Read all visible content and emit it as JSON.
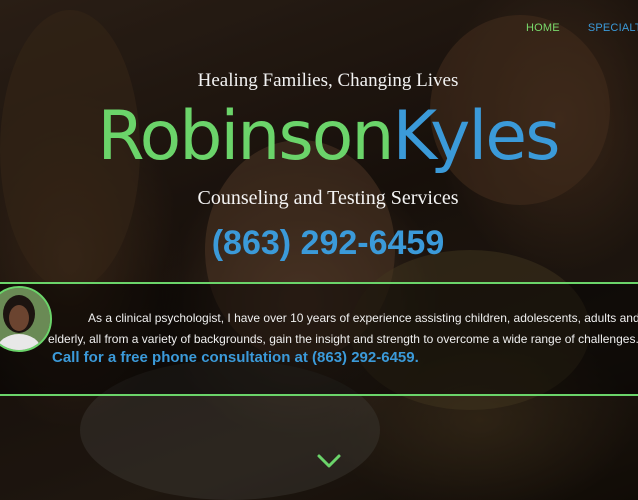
{
  "nav": {
    "items": [
      {
        "label": "HOME"
      },
      {
        "label": "SPECIALTIES"
      }
    ]
  },
  "hero": {
    "tagline": "Healing Families, Changing Lives",
    "brand_first": "Robinson",
    "brand_second": "Kyles",
    "subtitle": "Counseling and Testing Services",
    "phone": "(863) 292-6459"
  },
  "bio": {
    "line1": "As a clinical psychologist, I have over 10 years of experience assisting children, adolescents, adults and the",
    "line2": "elderly, all from a variety of backgrounds, gain the insight and strength to overcome a wide range of challenges.",
    "cta": "Call for a free phone consultation at (863) 292-6459."
  },
  "icons": {
    "scroll": "chevron-down-icon",
    "avatar": "avatar"
  },
  "colors": {
    "green": "#6bd46a",
    "blue": "#3b9ad9"
  }
}
